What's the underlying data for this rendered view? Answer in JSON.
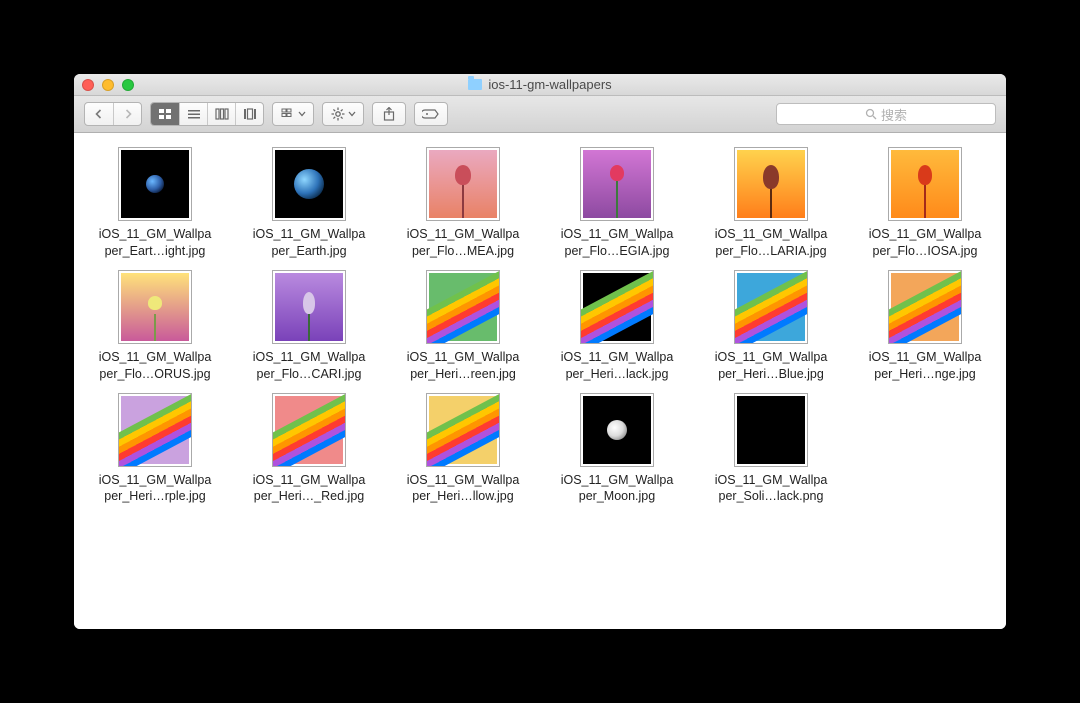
{
  "window": {
    "title": "ios-11-gm-wallpapers"
  },
  "search": {
    "placeholder": "搜索"
  },
  "files": [
    {
      "line1": "iOS_11_GM_Wallpa",
      "line2": "per_Eart…ight.jpg",
      "variant": "earth-small"
    },
    {
      "line1": "iOS_11_GM_Wallpa",
      "line2": "per_Earth.jpg",
      "variant": "earth-big"
    },
    {
      "line1": "iOS_11_GM_Wallpa",
      "line2": "per_Flo…MEA.jpg",
      "variant": "flower bg-sunset"
    },
    {
      "line1": "iOS_11_GM_Wallpa",
      "line2": "per_Flo…EGIA.jpg",
      "variant": "flower bg-pinkpurple"
    },
    {
      "line1": "iOS_11_GM_Wallpa",
      "line2": "per_Flo…LARIA.jpg",
      "variant": "flower bg-orange"
    },
    {
      "line1": "iOS_11_GM_Wallpa",
      "line2": "per_Flo…IOSA.jpg",
      "variant": "flower bg-orange2"
    },
    {
      "line1": "iOS_11_GM_Wallpa",
      "line2": "per_Flo…ORUS.jpg",
      "variant": "flower bg-dawn"
    },
    {
      "line1": "iOS_11_GM_Wallpa",
      "line2": "per_Flo…CARI.jpg",
      "variant": "flower bg-purple"
    },
    {
      "line1": "iOS_11_GM_Wallpa",
      "line2": "per_Heri…reen.jpg",
      "variant": "stripe sbg-green"
    },
    {
      "line1": "iOS_11_GM_Wallpa",
      "line2": "per_Heri…lack.jpg",
      "variant": "stripe sbg-black"
    },
    {
      "line1": "iOS_11_GM_Wallpa",
      "line2": "per_Heri…Blue.jpg",
      "variant": "stripe sbg-blue"
    },
    {
      "line1": "iOS_11_GM_Wallpa",
      "line2": "per_Heri…nge.jpg",
      "variant": "stripe sbg-orange"
    },
    {
      "line1": "iOS_11_GM_Wallpa",
      "line2": "per_Heri…rple.jpg",
      "variant": "stripe sbg-purple"
    },
    {
      "line1": "iOS_11_GM_Wallpa",
      "line2": "per_Heri…_Red.jpg",
      "variant": "stripe sbg-red"
    },
    {
      "line1": "iOS_11_GM_Wallpa",
      "line2": "per_Heri…llow.jpg",
      "variant": "stripe sbg-yellow"
    },
    {
      "line1": "iOS_11_GM_Wallpa",
      "line2": "per_Moon.jpg",
      "variant": "moon"
    },
    {
      "line1": "iOS_11_GM_Wallpa",
      "line2": "per_Soli…lack.png",
      "variant": "solid-black"
    }
  ]
}
